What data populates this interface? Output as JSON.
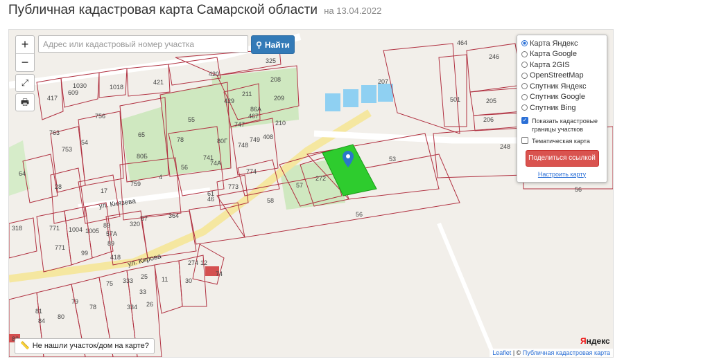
{
  "page": {
    "title": "Публичная кадастровая карта Самарской области",
    "date_prefix": "на",
    "date": "13.04.2022"
  },
  "toolbar": {
    "zoom_in": "+",
    "zoom_out": "−",
    "search_placeholder": "Адрес или кадастровый номер участка",
    "find_label": "Найти"
  },
  "layers": {
    "options": [
      {
        "label": "Карта Яндекс",
        "selected": true
      },
      {
        "label": "Карта Google",
        "selected": false
      },
      {
        "label": "Карта 2GIS",
        "selected": false
      },
      {
        "label": "OpenStreetMap",
        "selected": false
      },
      {
        "label": "Спутник Яндекс",
        "selected": false
      },
      {
        "label": "Спутник Google",
        "selected": false
      },
      {
        "label": "Спутник Bing",
        "selected": false
      }
    ],
    "show_boundaries_label": "Показать кадастровые границы участков",
    "show_boundaries_checked": true,
    "thematic_label": "Тематическая карта",
    "thematic_checked": false,
    "share_label": "Поделиться ссылкой",
    "setup_label": "Настроить карту"
  },
  "map": {
    "streets": [
      "ул. Князева",
      "ул. Кирова"
    ],
    "parcel_labels": [
      "325",
      "420",
      "421",
      "1018",
      "1030",
      "609",
      "417",
      "208",
      "211",
      "209",
      "429",
      "467",
      "747",
      "86А",
      "210",
      "748",
      "749",
      "408",
      "55",
      "65",
      "78",
      "80Б",
      "80Г",
      "741",
      "74А",
      "56",
      "759",
      "4",
      "17",
      "28",
      "54",
      "753",
      "756",
      "763",
      "64",
      "774",
      "773",
      "57",
      "272",
      "53",
      "58",
      "61",
      "46",
      "364",
      "57",
      "320",
      "418",
      "89",
      "57А",
      "89",
      "1005",
      "1004",
      "771",
      "771",
      "318",
      "99",
      "274",
      "12",
      "74",
      "11",
      "30",
      "25",
      "333",
      "33",
      "26",
      "75",
      "78",
      "79",
      "80",
      "81",
      "84",
      "82",
      "334",
      "207",
      "501",
      "205",
      "206",
      "248",
      "246",
      "464",
      "56",
      "56"
    ],
    "not_found_label": "Не нашли участок/дом на карте?",
    "attribution_leaflet": "Leaflet",
    "attribution_sep": " | © ",
    "attribution_source": "Публичная кадастровая карта",
    "yandex_logo_first": "Я",
    "yandex_logo_rest": "ндекс"
  },
  "colors": {
    "selected_parcel": "#2ecc2e",
    "parcel_border": "#b03040",
    "find_button": "#337ab7",
    "share_button": "#d9534f",
    "road": "#f5e7a0",
    "green_area": "#cfe8c0",
    "water": "#8fd0f2"
  }
}
